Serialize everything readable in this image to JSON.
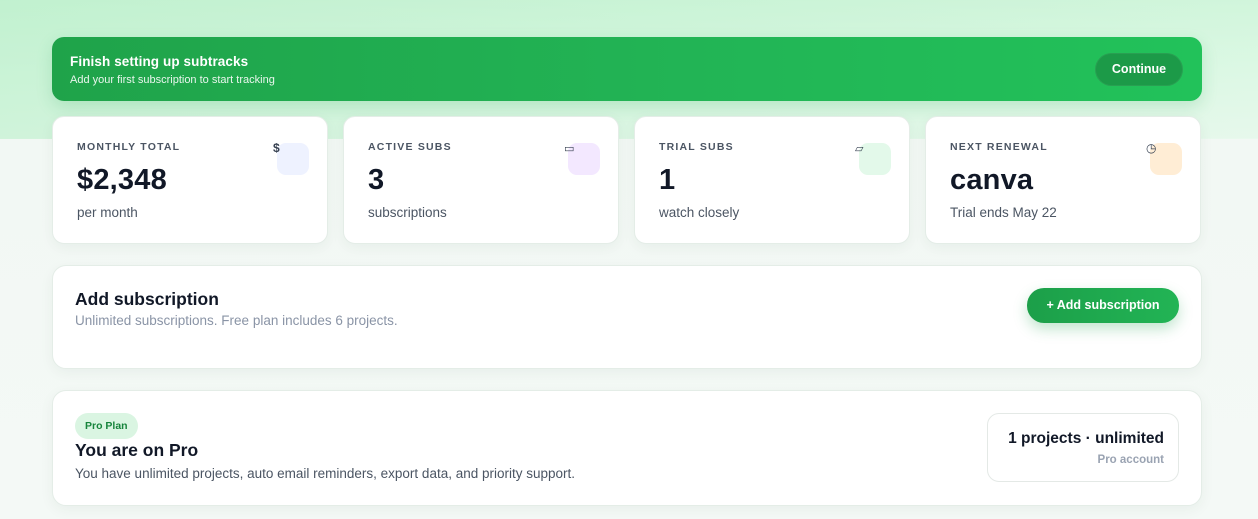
{
  "banner": {
    "title": "Finish setting up subtracks",
    "subtitle": "Add your first subscription to start tracking",
    "button": "Continue"
  },
  "stats": [
    {
      "label": "MONTHLY TOTAL",
      "value": "$2,348",
      "sub": "per month",
      "icon": "dollar-icon",
      "glyph": "$",
      "icon_bg": "#eef2ff"
    },
    {
      "label": "ACTIVE SUBS",
      "value": "3",
      "sub": "subscriptions",
      "icon": "card-icon",
      "glyph": "▭",
      "icon_bg": "#f3e8ff"
    },
    {
      "label": "TRIAL SUBS",
      "value": "1",
      "sub": "watch closely",
      "icon": "ticket-icon",
      "glyph": "▱",
      "icon_bg": "#e3f9ea"
    },
    {
      "label": "NEXT RENEWAL",
      "value": "canva",
      "sub": "Trial ends May 22",
      "icon": "clock-icon",
      "glyph": "◷",
      "icon_bg": "#ffedd5"
    }
  ],
  "add_card": {
    "title": "Add subscription",
    "subtitle": "Unlimited subscriptions. Free plan includes 6 projects.",
    "button": "+ Add subscription"
  },
  "plan_card": {
    "badge": "Pro Plan",
    "title": "You are on Pro",
    "subtitle": "You have unlimited projects, auto email reminders, export data, and priority support.",
    "box_main": "1 projects · unlimited",
    "box_sub": "Pro account"
  },
  "colors": {
    "accent": "#22b455",
    "accent_dark": "#1c9a48"
  }
}
